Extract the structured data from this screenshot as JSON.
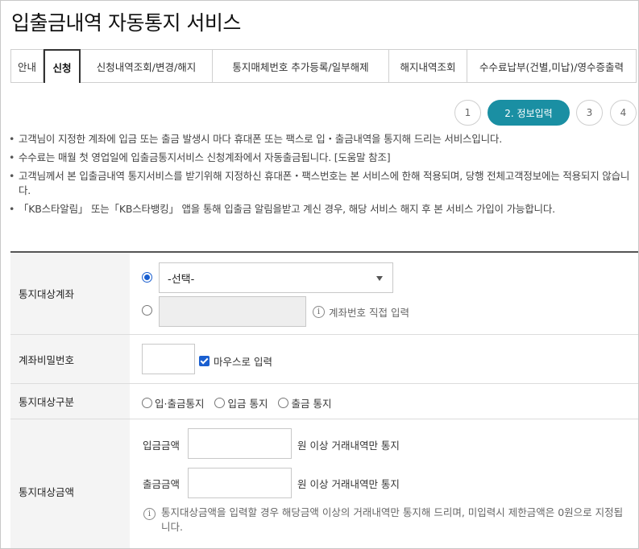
{
  "page": {
    "title": "입출금내역 자동통지 서비스"
  },
  "tabs": [
    {
      "label": "안내"
    },
    {
      "label": "신청"
    },
    {
      "label": "신청내역조회/변경/해지"
    },
    {
      "label": "통지매체번호 추가등록/일부해제"
    },
    {
      "label": "해지내역조회"
    },
    {
      "label": "수수료납부(건별,미납)/영수증출력"
    }
  ],
  "steps": [
    {
      "label": "1"
    },
    {
      "label": "2. 정보입력"
    },
    {
      "label": "3"
    },
    {
      "label": "4"
    }
  ],
  "notes": [
    "고객님이 지정한 계좌에 입금 또는 출금 발생시 마다 휴대폰 또는 팩스로 입・출금내역을 통지해 드리는 서비스입니다.",
    "수수료는 매월 첫 영업일에 입출금통지서비스 신청계좌에서 자동출금됩니다. [도움말 참조]",
    "고객님께서 본 입출금내역 통지서비스를 받기위해 지정하신 휴대폰・팩스번호는 본 서비스에 한해 적용되며, 당행 전체고객정보에는 적용되지 않습니다.",
    "「KB스타알림」 또는「KB스타뱅킹」 앱을 통해 입출금 알림을받고 계신 경우, 해당 서비스 해지 후 본 서비스 가입이 가능합니다."
  ],
  "form": {
    "account": {
      "label": "통지대상계좌",
      "select_value": "-선택-",
      "direct_input_value": "",
      "direct_hint": "계좌번호 직접 입력"
    },
    "password": {
      "label": "계좌비밀번호",
      "value": "",
      "mouse_label": "마우스로 입력"
    },
    "type": {
      "label": "통지대상구분",
      "options": [
        "입·출금통지",
        "입금 통지",
        "출금 통지"
      ]
    },
    "amount": {
      "label": "통지대상금액",
      "deposit_label": "입금금액",
      "deposit_value": "",
      "deposit_suffix": "원 이상 거래내역만 통지",
      "withdraw_label": "출금금액",
      "withdraw_value": "",
      "withdraw_suffix": "원 이상 거래내역만 통지",
      "info": "통지대상금액을 입력할 경우 해당금액 이상의 거래내역만 통지해 드리며, 미입력시 제한금액은 0원으로 지정됩니다."
    }
  },
  "icons": {
    "info": "info-icon",
    "caret": "chevron-down-icon"
  },
  "colors": {
    "accent": "#1a8fa3",
    "control": "#1a5fd0"
  }
}
